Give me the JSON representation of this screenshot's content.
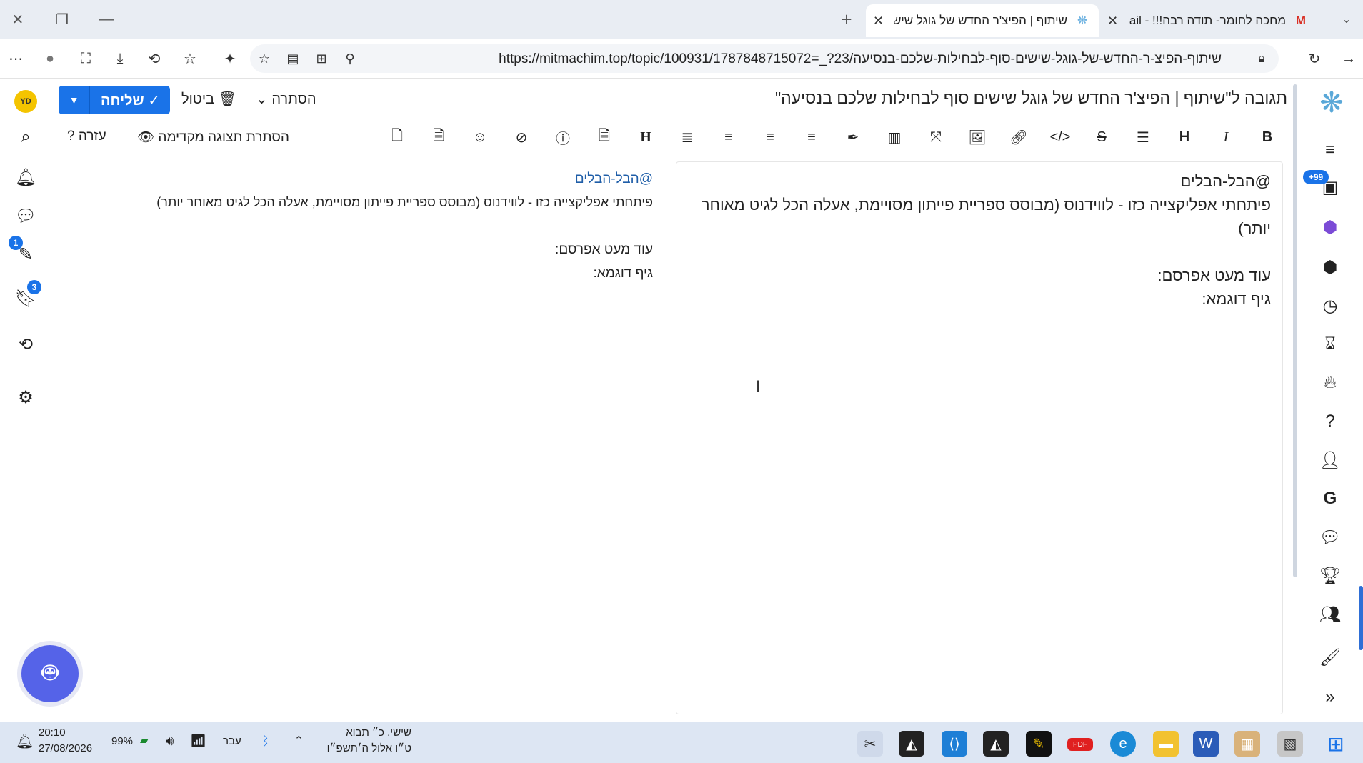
{
  "browser": {
    "tabs": [
      {
        "title": "מחכה לחומר- תודה רבה!!! - Gmail",
        "icon": "gmail-icon",
        "active": false
      },
      {
        "title": "שיתוף | הפיצ'ר החדש של גוגל שיש",
        "icon": "site-icon",
        "active": true
      }
    ],
    "url": "https://mitmachim.top/topic/100931/1787848715072=_?23/שיתוף-הפיצ-ר-החדש-של-גוגל-שישים-סוף-לבחילות-שלכם-בנסיעה"
  },
  "composer": {
    "title": "תגובה ל\"שיתוף | הפיצ'ר החדש של גוגל שישים סוף לבחילות שלכם בנסיעה\"",
    "send_label": "שליחה",
    "cancel_label": "ביטול",
    "hide_label": "הסתרה",
    "hide_preview_label": "הסתרת תצוגה מקדימה",
    "help_label": "עזרה",
    "editor_lines": [
      "@הבל-הבלים",
      "פיתחתי אפליקצייה כזו - לווידנוס (מבוסס ספריית פייתון מסויימת, אעלה הכל לגיט מאוחר יותר)",
      "",
      "עוד מעט אפרסם:",
      "גיף דוגמא:"
    ],
    "preview": {
      "mention": "@הבל-הבלים",
      "line1": "פיתחתי אפליקצייה כזו - לווידנוס (מבוסס ספריית פייתון מסויימת, אעלה הכל לגיט מאוחר יותר)",
      "line2": "עוד מעט אפרסם:",
      "line3": "גיף דוגמא:"
    }
  },
  "left_rail": {
    "avatar_initials": "YD",
    "drafts_badge": "1",
    "bookmarks_badge": "3"
  },
  "right_rail": {
    "notifications_badge": "+99"
  },
  "taskbar": {
    "time": "20:10",
    "date": "27/08/2026",
    "battery": "99%",
    "language": "עבר",
    "hebrew_date_line1": "שישי, כ״ תבוא",
    "hebrew_date_line2": "ט״ו אלול ה׳תשפ״ו"
  },
  "colors": {
    "accent": "#1a73e8",
    "mention": "#1f5ea8"
  }
}
